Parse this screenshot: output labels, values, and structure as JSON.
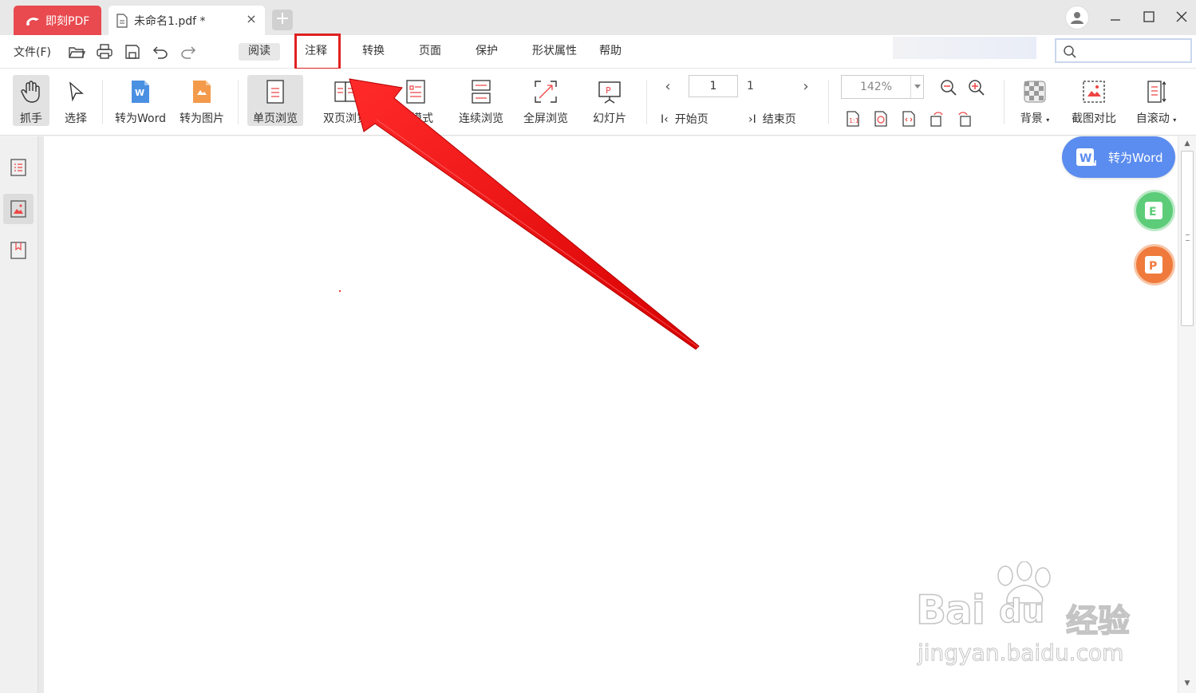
{
  "titlebar": {
    "brand_label": "即刻PDF",
    "doc_tab_label": "未命名1.pdf *",
    "tab_close_glyph": "×",
    "new_tab_glyph": "+"
  },
  "menubar": {
    "file_label": "文件(F)",
    "items": [
      "阅读",
      "注释",
      "转换",
      "页面",
      "保护",
      "形状属性",
      "帮助"
    ],
    "highlighted_item": "注释",
    "search_placeholder": ""
  },
  "toolbar": {
    "tools": [
      "抓手",
      "选择",
      "转为Word",
      "转为图片",
      "单页浏览",
      "双页浏览",
      "书模式",
      "连续浏览",
      "全屏浏览",
      "幻灯片"
    ],
    "visible_partial_label": "模式",
    "active_tool": "单页浏览",
    "nav": {
      "prev_glyph": "‹",
      "next_glyph": "›",
      "current_page": "1",
      "total_pages": "1",
      "first_page_label": "开始页",
      "last_page_label": "结束页",
      "first_glyph": "I‹",
      "last_glyph": "›I"
    },
    "zoom": "142%",
    "right_tools": [
      "背景",
      "截图对比",
      "自滚动"
    ]
  },
  "floating": {
    "word_label": "转为Word",
    "excel_letter": "E",
    "ppt_letter": "P",
    "word_letter": "W"
  },
  "watermark": {
    "brand": "Bai",
    "brand2": "du",
    "product": "经验",
    "url": "jingyan.baidu.com"
  },
  "colors": {
    "brand_red": "#e84a4f",
    "highlight_red": "#e02020",
    "word_blue": "#5b8cef",
    "excel_green": "#5ccc78",
    "ppt_orange": "#ef7a3b"
  }
}
